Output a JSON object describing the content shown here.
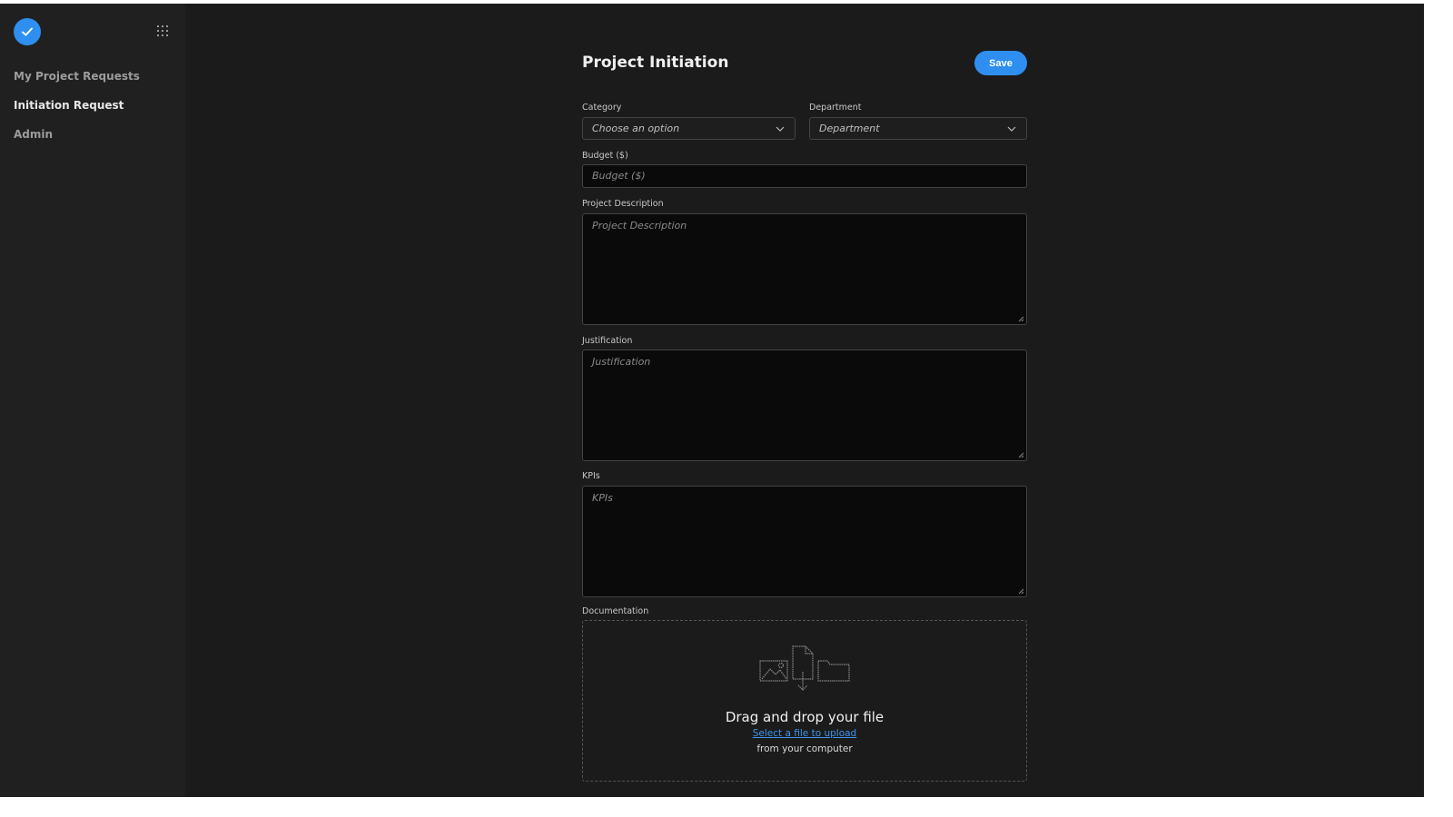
{
  "sidebar": {
    "logo_icon": "check-circle-icon",
    "apps_icon": "grid-dots-icon",
    "items": [
      {
        "label": "My Project Requests",
        "active": false
      },
      {
        "label": "Initiation Request",
        "active": true
      },
      {
        "label": "Admin",
        "active": false
      }
    ]
  },
  "form": {
    "title": "Project Initiation",
    "save_label": "Save",
    "category": {
      "label": "Category",
      "placeholder": "Choose an option"
    },
    "department": {
      "label": "Department",
      "placeholder": "Department"
    },
    "budget": {
      "label": "Budget ($)",
      "placeholder": "Budget ($)",
      "value": ""
    },
    "description": {
      "label": "Project Description",
      "placeholder": "Project Description",
      "value": ""
    },
    "justification": {
      "label": "Justification",
      "placeholder": "Justification",
      "value": ""
    },
    "kpis": {
      "label": "KPIs",
      "placeholder": "KPIs",
      "value": ""
    },
    "documentation": {
      "label": "Documentation",
      "drop_title": "Drag and drop your file",
      "select_link": "Select a file to upload",
      "subtext": "from your computer"
    }
  },
  "colors": {
    "accent": "#2e8ff0",
    "background": "#1b1b1b",
    "sidebar": "#202020",
    "input_bg": "#0a0a0a"
  }
}
